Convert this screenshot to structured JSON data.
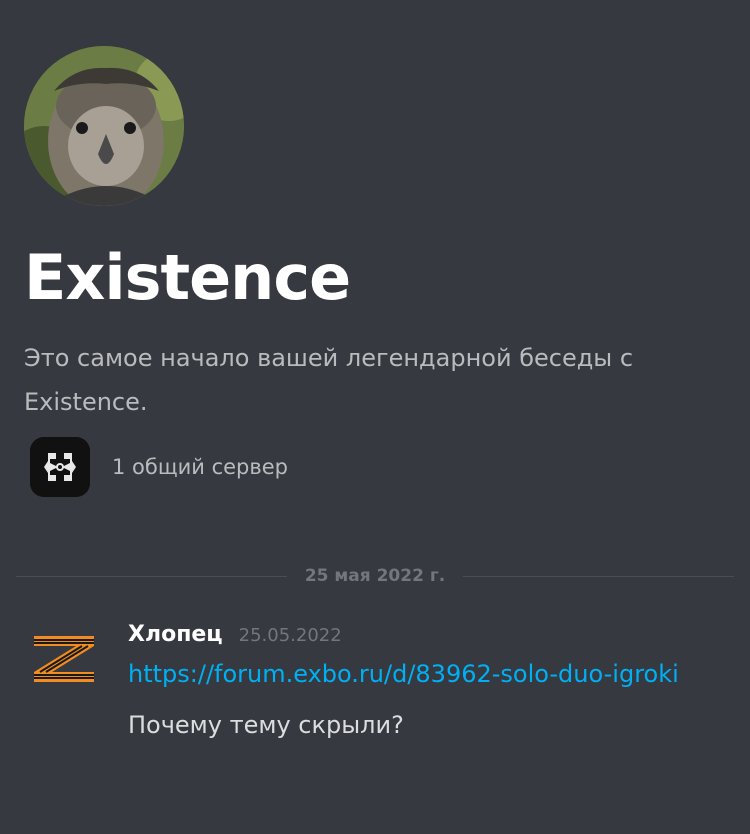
{
  "channel": {
    "title": "Existence",
    "intro": "Это самое начало вашей легендарной беседы с Existence.",
    "mutual_servers": "1 общий сервер"
  },
  "divider": {
    "date": "25 мая 2022 г."
  },
  "message": {
    "author": "Хлопец",
    "timestamp": "25.05.2022",
    "link": "https://forum.exbo.ru/d/83962-solo-duo-igroki",
    "text": "Почему тему скрыли?"
  },
  "colors": {
    "background": "#36393f",
    "link": "#00b0f4",
    "muted": "#72767d"
  },
  "icons": {
    "user_avatar": "eagle-avatar-icon",
    "server_icon": "server-emblem-icon",
    "author_avatar": "z-ribbon-avatar-icon"
  }
}
